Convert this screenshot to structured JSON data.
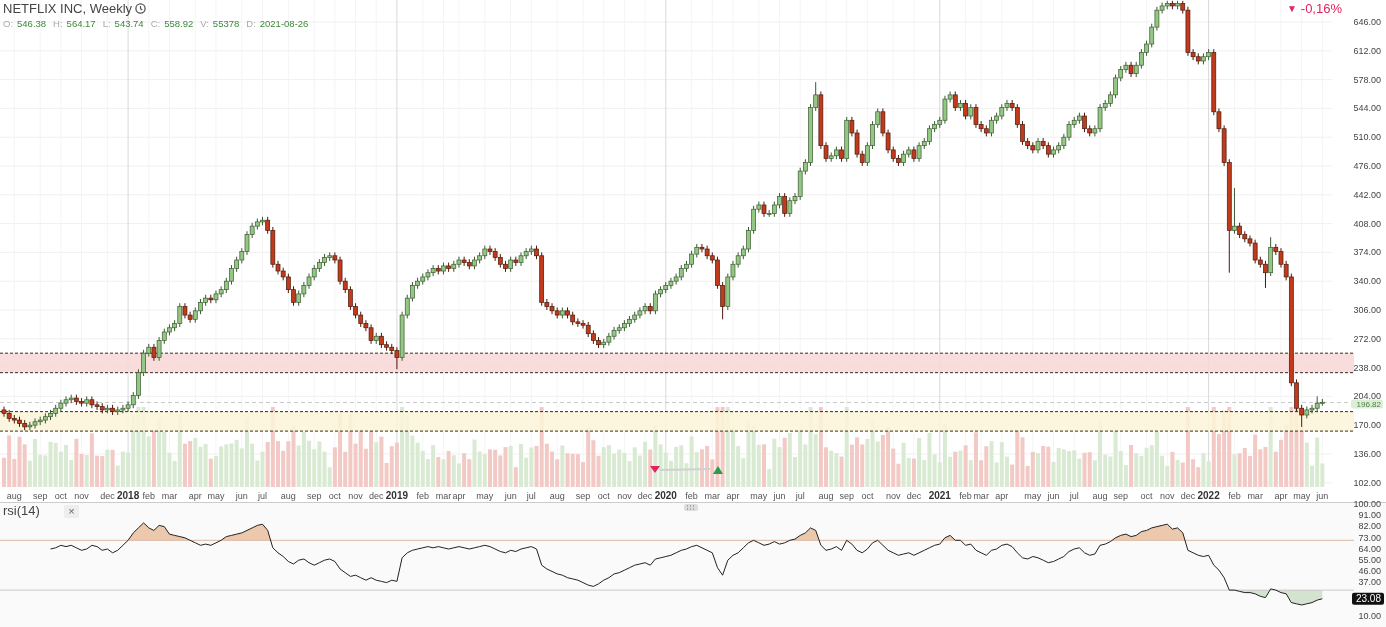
{
  "header": {
    "title": "NETFLIX INC, Weekly",
    "ohlc": [
      {
        "label": "O:",
        "value": "546.38"
      },
      {
        "label": "H:",
        "value": "564.17"
      },
      {
        "label": "L:",
        "value": "543.74"
      },
      {
        "label": "C:",
        "value": "558.92"
      },
      {
        "label": "V:",
        "value": "55378"
      },
      {
        "label": "D:",
        "value": "2021-08-26"
      }
    ]
  },
  "change": {
    "arrow": "▼",
    "text": "-0,16%"
  },
  "price_chart": {
    "chart_data": {
      "type": "candlestick",
      "ylim": [
        97,
        672
      ],
      "grid": true,
      "categories": [
        null,
        null,
        "aug",
        null,
        null,
        null,
        null,
        "sep",
        null,
        null,
        null,
        "oct",
        null,
        null,
        null,
        "nov",
        null,
        null,
        null,
        null,
        "dec",
        null,
        null,
        null,
        "2018",
        null,
        null,
        null,
        "feb",
        null,
        null,
        null,
        "mar",
        null,
        null,
        null,
        null,
        "apr",
        null,
        null,
        null,
        "may",
        null,
        null,
        null,
        null,
        "jun",
        null,
        null,
        null,
        "jul",
        null,
        null,
        null,
        null,
        "aug",
        null,
        null,
        null,
        null,
        "sep",
        null,
        null,
        null,
        "oct",
        null,
        null,
        null,
        "nov",
        null,
        null,
        null,
        "dec",
        null,
        null,
        null,
        "2019",
        null,
        null,
        null,
        null,
        "feb",
        null,
        null,
        null,
        "mar",
        null,
        null,
        "apr",
        null,
        null,
        null,
        null,
        "may",
        null,
        null,
        null,
        null,
        "jun",
        null,
        null,
        null,
        "jul",
        null,
        null,
        null,
        null,
        "aug",
        null,
        null,
        null,
        null,
        "sep",
        null,
        null,
        null,
        "oct",
        null,
        null,
        null,
        "nov",
        null,
        null,
        null,
        "dec",
        null,
        null,
        null,
        "2020",
        null,
        null,
        null,
        null,
        "feb",
        null,
        null,
        null,
        "mar",
        null,
        null,
        null,
        "apr",
        null,
        null,
        null,
        null,
        "may",
        null,
        null,
        null,
        "jun",
        null,
        null,
        null,
        "jul",
        null,
        null,
        null,
        null,
        "aug",
        null,
        null,
        null,
        "sep",
        null,
        null,
        null,
        "oct",
        null,
        null,
        null,
        null,
        "nov",
        null,
        null,
        null,
        "dec",
        null,
        null,
        null,
        null,
        "2021",
        null,
        null,
        null,
        null,
        "feb",
        null,
        null,
        "mar",
        null,
        null,
        null,
        "apr",
        null,
        null,
        null,
        null,
        null,
        "may",
        null,
        null,
        null,
        "jun",
        null,
        null,
        null,
        "jul",
        null,
        null,
        null,
        null,
        "aug",
        null,
        null,
        null,
        "sep",
        null,
        null,
        null,
        null,
        "oct",
        null,
        null,
        null,
        "nov",
        null,
        null,
        null,
        "dec",
        null,
        null,
        null,
        "2022",
        null,
        null,
        null,
        null,
        "feb",
        null,
        null,
        null,
        "mar",
        null,
        null,
        null,
        null,
        "apr",
        null,
        null,
        null,
        "may",
        null,
        null,
        null,
        "jun"
      ],
      "ohlc": [
        [
          188,
          192,
          180,
          184
        ],
        [
          184,
          188,
          174,
          178
        ],
        [
          178,
          182,
          172,
          176
        ],
        [
          176,
          180,
          168,
          172
        ],
        [
          172,
          176,
          164,
          168
        ],
        [
          168,
          174,
          164,
          170
        ],
        [
          170,
          178,
          166,
          174
        ],
        [
          174,
          180,
          170,
          176
        ],
        [
          176,
          184,
          172,
          180
        ],
        [
          180,
          188,
          176,
          184
        ],
        [
          184,
          194,
          180,
          190
        ],
        [
          190,
          200,
          186,
          196
        ],
        [
          196,
          204,
          192,
          200
        ],
        [
          200,
          206,
          196,
          202
        ],
        [
          202,
          206,
          194,
          198
        ],
        [
          198,
          202,
          192,
          196
        ],
        [
          196,
          204,
          192,
          200
        ],
        [
          200,
          204,
          190,
          194
        ],
        [
          194,
          198,
          188,
          192
        ],
        [
          192,
          196,
          184,
          188
        ],
        [
          188,
          194,
          184,
          190
        ],
        [
          190,
          194,
          182,
          186
        ],
        [
          186,
          192,
          182,
          188
        ],
        [
          188,
          194,
          184,
          190
        ],
        [
          190,
          198,
          186,
          194
        ],
        [
          194,
          209,
          190,
          205
        ],
        [
          205,
          236,
          201,
          232
        ],
        [
          232,
          259,
          228,
          255
        ],
        [
          255,
          266,
          251,
          262
        ],
        [
          262,
          266,
          246,
          250
        ],
        [
          250,
          274,
          246,
          270
        ],
        [
          270,
          284,
          266,
          280
        ],
        [
          280,
          289,
          276,
          285
        ],
        [
          285,
          294,
          281,
          290
        ],
        [
          290,
          314,
          286,
          310
        ],
        [
          310,
          314,
          296,
          300
        ],
        [
          300,
          304,
          291,
          295
        ],
        [
          295,
          309,
          291,
          305
        ],
        [
          305,
          319,
          301,
          315
        ],
        [
          315,
          324,
          311,
          320
        ],
        [
          320,
          324,
          314,
          318
        ],
        [
          318,
          329,
          314,
          325
        ],
        [
          325,
          334,
          321,
          330
        ],
        [
          330,
          344,
          326,
          340
        ],
        [
          340,
          359,
          336,
          355
        ],
        [
          355,
          369,
          351,
          365
        ],
        [
          365,
          379,
          361,
          375
        ],
        [
          375,
          399,
          371,
          395
        ],
        [
          395,
          409,
          391,
          405
        ],
        [
          405,
          414,
          401,
          410
        ],
        [
          410,
          416,
          406,
          412
        ],
        [
          412,
          416,
          396,
          400
        ],
        [
          400,
          404,
          356,
          360
        ],
        [
          360,
          364,
          348,
          352
        ],
        [
          352,
          356,
          341,
          345
        ],
        [
          345,
          349,
          326,
          330
        ],
        [
          330,
          334,
          311,
          315
        ],
        [
          315,
          329,
          311,
          325
        ],
        [
          325,
          339,
          321,
          335
        ],
        [
          335,
          349,
          331,
          345
        ],
        [
          345,
          359,
          341,
          355
        ],
        [
          355,
          366,
          351,
          362
        ],
        [
          362,
          372,
          358,
          368
        ],
        [
          368,
          374,
          364,
          370
        ],
        [
          370,
          374,
          361,
          365
        ],
        [
          365,
          369,
          336,
          340
        ],
        [
          340,
          344,
          326,
          330
        ],
        [
          330,
          334,
          306,
          310
        ],
        [
          310,
          314,
          296,
          300
        ],
        [
          300,
          304,
          286,
          290
        ],
        [
          290,
          294,
          281,
          285
        ],
        [
          285,
          289,
          266,
          270
        ],
        [
          270,
          279,
          266,
          275
        ],
        [
          275,
          279,
          261,
          265
        ],
        [
          265,
          269,
          258,
          262
        ],
        [
          262,
          266,
          254,
          258
        ],
        [
          258,
          262,
          236,
          250
        ],
        [
          250,
          304,
          246,
          300
        ],
        [
          300,
          324,
          296,
          320
        ],
        [
          320,
          339,
          316,
          335
        ],
        [
          335,
          344,
          331,
          340
        ],
        [
          340,
          349,
          336,
          345
        ],
        [
          345,
          354,
          341,
          350
        ],
        [
          350,
          359,
          346,
          355
        ],
        [
          355,
          359,
          348,
          352
        ],
        [
          352,
          362,
          348,
          358
        ],
        [
          358,
          362,
          351,
          355
        ],
        [
          355,
          364,
          351,
          360
        ],
        [
          360,
          369,
          356,
          365
        ],
        [
          365,
          369,
          358,
          362
        ],
        [
          362,
          366,
          354,
          358
        ],
        [
          358,
          369,
          354,
          365
        ],
        [
          365,
          374,
          361,
          370
        ],
        [
          370,
          382,
          366,
          378
        ],
        [
          378,
          382,
          371,
          375
        ],
        [
          375,
          379,
          364,
          368
        ],
        [
          368,
          372,
          356,
          360
        ],
        [
          360,
          364,
          351,
          355
        ],
        [
          355,
          369,
          351,
          365
        ],
        [
          365,
          369,
          358,
          362
        ],
        [
          362,
          374,
          358,
          370
        ],
        [
          370,
          379,
          366,
          375
        ],
        [
          375,
          382,
          371,
          378
        ],
        [
          378,
          382,
          366,
          370
        ],
        [
          370,
          374,
          311,
          315
        ],
        [
          315,
          319,
          306,
          310
        ],
        [
          310,
          314,
          301,
          305
        ],
        [
          305,
          309,
          296,
          300
        ],
        [
          300,
          309,
          296,
          305
        ],
        [
          305,
          309,
          296,
          300
        ],
        [
          300,
          304,
          288,
          292
        ],
        [
          292,
          296,
          286,
          290
        ],
        [
          290,
          294,
          284,
          288
        ],
        [
          288,
          292,
          274,
          278
        ],
        [
          278,
          282,
          266,
          270
        ],
        [
          270,
          274,
          261,
          265
        ],
        [
          265,
          272,
          261,
          268
        ],
        [
          268,
          279,
          264,
          275
        ],
        [
          275,
          286,
          271,
          282
        ],
        [
          282,
          289,
          278,
          285
        ],
        [
          285,
          294,
          281,
          290
        ],
        [
          290,
          299,
          286,
          295
        ],
        [
          295,
          304,
          291,
          300
        ],
        [
          300,
          309,
          296,
          305
        ],
        [
          305,
          314,
          301,
          310
        ],
        [
          310,
          314,
          301,
          305
        ],
        [
          305,
          329,
          301,
          325
        ],
        [
          325,
          334,
          321,
          330
        ],
        [
          330,
          339,
          326,
          335
        ],
        [
          335,
          344,
          331,
          340
        ],
        [
          340,
          349,
          336,
          345
        ],
        [
          345,
          359,
          341,
          355
        ],
        [
          355,
          364,
          351,
          360
        ],
        [
          360,
          376,
          356,
          372
        ],
        [
          372,
          384,
          368,
          380
        ],
        [
          380,
          384,
          374,
          378
        ],
        [
          378,
          382,
          366,
          370
        ],
        [
          370,
          374,
          361,
          365
        ],
        [
          365,
          369,
          331,
          335
        ],
        [
          335,
          339,
          295,
          310
        ],
        [
          310,
          349,
          306,
          345
        ],
        [
          345,
          364,
          341,
          360
        ],
        [
          360,
          374,
          356,
          370
        ],
        [
          370,
          382,
          366,
          378
        ],
        [
          378,
          404,
          374,
          400
        ],
        [
          400,
          429,
          396,
          425
        ],
        [
          425,
          434,
          421,
          430
        ],
        [
          430,
          434,
          416,
          420
        ],
        [
          420,
          424,
          416,
          420
        ],
        [
          420,
          434,
          416,
          430
        ],
        [
          430,
          444,
          426,
          440
        ],
        [
          440,
          444,
          416,
          420
        ],
        [
          420,
          439,
          416,
          435
        ],
        [
          435,
          444,
          431,
          440
        ],
        [
          440,
          474,
          436,
          470
        ],
        [
          470,
          484,
          466,
          480
        ],
        [
          480,
          549,
          476,
          545
        ],
        [
          545,
          575,
          541,
          560
        ],
        [
          560,
          564,
          496,
          500
        ],
        [
          500,
          504,
          481,
          485
        ],
        [
          485,
          492,
          481,
          488
        ],
        [
          488,
          499,
          484,
          495
        ],
        [
          495,
          499,
          481,
          485
        ],
        [
          485,
          534,
          481,
          530
        ],
        [
          530,
          534,
          511,
          515
        ],
        [
          515,
          519,
          486,
          490
        ],
        [
          490,
          494,
          476,
          480
        ],
        [
          480,
          504,
          476,
          500
        ],
        [
          500,
          529,
          496,
          525
        ],
        [
          525,
          544,
          521,
          540
        ],
        [
          540,
          544,
          511,
          515
        ],
        [
          515,
          519,
          491,
          495
        ],
        [
          495,
          499,
          481,
          485
        ],
        [
          485,
          489,
          476,
          480
        ],
        [
          480,
          494,
          476,
          490
        ],
        [
          490,
          499,
          486,
          495
        ],
        [
          495,
          499,
          481,
          485
        ],
        [
          485,
          504,
          481,
          500
        ],
        [
          500,
          509,
          496,
          505
        ],
        [
          505,
          524,
          501,
          520
        ],
        [
          520,
          529,
          516,
          525
        ],
        [
          525,
          534,
          521,
          530
        ],
        [
          530,
          559,
          526,
          555
        ],
        [
          555,
          564,
          551,
          560
        ],
        [
          560,
          564,
          541,
          545
        ],
        [
          545,
          554,
          541,
          550
        ],
        [
          550,
          554,
          531,
          535
        ],
        [
          535,
          549,
          531,
          545
        ],
        [
          545,
          549,
          521,
          525
        ],
        [
          525,
          529,
          516,
          520
        ],
        [
          520,
          524,
          511,
          515
        ],
        [
          515,
          534,
          511,
          530
        ],
        [
          530,
          539,
          526,
          535
        ],
        [
          535,
          549,
          531,
          545
        ],
        [
          545,
          554,
          541,
          550
        ],
        [
          550,
          554,
          541,
          545
        ],
        [
          545,
          549,
          521,
          525
        ],
        [
          525,
          529,
          501,
          505
        ],
        [
          505,
          509,
          496,
          500
        ],
        [
          500,
          504,
          491,
          495
        ],
        [
          495,
          509,
          491,
          505
        ],
        [
          505,
          509,
          496,
          500
        ],
        [
          500,
          504,
          486,
          490
        ],
        [
          490,
          499,
          486,
          495
        ],
        [
          495,
          504,
          491,
          500
        ],
        [
          500,
          514,
          496,
          510
        ],
        [
          510,
          529,
          506,
          525
        ],
        [
          525,
          534,
          521,
          530
        ],
        [
          530,
          539,
          526,
          535
        ],
        [
          535,
          539,
          516,
          520
        ],
        [
          520,
          524,
          511,
          515
        ],
        [
          515,
          524,
          511,
          520
        ],
        [
          520,
          549,
          516,
          545
        ],
        [
          545,
          554,
          541,
          550
        ],
        [
          550,
          564,
          546,
          560
        ],
        [
          560,
          584,
          556,
          580
        ],
        [
          580,
          594,
          576,
          590
        ],
        [
          590,
          599,
          586,
          595
        ],
        [
          595,
          599,
          581,
          585
        ],
        [
          585,
          599,
          581,
          595
        ],
        [
          595,
          614,
          591,
          610
        ],
        [
          610,
          624,
          606,
          620
        ],
        [
          620,
          644,
          616,
          640
        ],
        [
          640,
          664,
          636,
          660
        ],
        [
          660,
          669,
          656,
          665
        ],
        [
          665,
          671,
          661,
          668
        ],
        [
          668,
          671,
          661,
          665
        ],
        [
          665,
          671,
          661,
          668
        ],
        [
          668,
          671,
          656,
          660
        ],
        [
          660,
          664,
          606,
          610
        ],
        [
          610,
          614,
          601,
          605
        ],
        [
          605,
          609,
          596,
          600
        ],
        [
          600,
          609,
          596,
          605
        ],
        [
          605,
          614,
          601,
          610
        ],
        [
          610,
          614,
          536,
          540
        ],
        [
          540,
          544,
          516,
          520
        ],
        [
          520,
          524,
          476,
          480
        ],
        [
          480,
          484,
          350,
          400
        ],
        [
          400,
          450,
          396,
          405
        ],
        [
          405,
          409,
          391,
          395
        ],
        [
          395,
          399,
          386,
          390
        ],
        [
          390,
          394,
          381,
          385
        ],
        [
          385,
          389,
          361,
          365
        ],
        [
          365,
          369,
          356,
          360
        ],
        [
          360,
          364,
          332,
          350
        ],
        [
          350,
          392,
          346,
          380
        ],
        [
          380,
          384,
          371,
          375
        ],
        [
          375,
          379,
          356,
          360
        ],
        [
          360,
          364,
          341,
          345
        ],
        [
          345,
          349,
          216,
          220
        ],
        [
          220,
          224,
          186,
          190
        ],
        [
          190,
          194,
          168,
          182
        ],
        [
          182,
          192,
          178,
          188
        ],
        [
          188,
          194,
          184,
          190
        ],
        [
          190,
          204,
          186,
          196
        ],
        [
          196,
          201,
          193,
          197
        ]
      ],
      "yticks": [
        {
          "value": 646,
          "label": "646.00"
        },
        {
          "value": 612,
          "label": "612.00"
        },
        {
          "value": 578,
          "label": "578.00"
        },
        {
          "value": 544,
          "label": "544.00"
        },
        {
          "value": 510,
          "label": "510.00"
        },
        {
          "value": 476,
          "label": "476.00"
        },
        {
          "value": 442,
          "label": "442.00"
        },
        {
          "value": 408,
          "label": "408.00"
        },
        {
          "value": 374,
          "label": "374.00"
        },
        {
          "value": 340,
          "label": "340.00"
        },
        {
          "value": 306,
          "label": "306.00"
        },
        {
          "value": 272,
          "label": "272.00"
        },
        {
          "value": 238,
          "label": "238.00"
        },
        {
          "value": 204,
          "label": "204.00"
        },
        {
          "value": 170,
          "label": "170.00"
        },
        {
          "value": 136,
          "label": "136.00"
        },
        {
          "value": 102,
          "label": "102.00"
        }
      ],
      "bands": [
        {
          "axis": "y",
          "from": 232,
          "to": 255,
          "color": "#f8d6d6"
        },
        {
          "axis": "y",
          "from": 163,
          "to": 186,
          "color": "#fcf5d8"
        }
      ],
      "ref_lines": [
        {
          "axis": "y",
          "value": 196.82,
          "label": "196.82"
        }
      ]
    }
  },
  "rsi": {
    "title": "rsi(14)",
    "close_label": "×",
    "reading": "23.08",
    "chart_data": {
      "type": "line",
      "ylim": [
        10,
        100
      ],
      "series": [
        {
          "values": [
            null,
            null,
            null,
            null,
            null,
            null,
            null,
            null,
            null,
            63,
            64,
            66,
            65,
            66,
            64,
            62,
            63,
            66,
            65,
            62,
            63,
            60,
            62,
            66,
            70,
            76,
            80,
            84,
            80,
            78,
            82,
            81,
            75,
            74,
            73,
            72,
            70,
            68,
            66,
            67,
            66,
            68,
            70,
            73,
            74,
            75,
            76,
            78,
            80,
            82,
            83,
            78,
            64,
            60,
            57,
            53,
            51,
            54,
            55,
            52,
            50,
            52,
            54,
            55,
            53,
            47,
            44,
            41,
            42,
            40,
            38,
            40,
            38,
            37,
            36,
            38,
            37,
            56,
            60,
            62,
            63,
            64,
            65,
            64,
            65,
            64,
            63,
            64,
            65,
            64,
            63,
            64,
            65,
            66,
            65,
            63,
            61,
            60,
            62,
            61,
            63,
            64,
            65,
            63,
            50,
            47,
            45,
            43,
            42,
            40,
            39,
            38,
            36,
            34,
            33,
            35,
            38,
            40,
            43,
            44,
            46,
            48,
            50,
            51,
            52,
            50,
            55,
            56,
            57,
            58,
            60,
            62,
            63,
            65,
            66,
            64,
            62,
            60,
            48,
            42,
            54,
            58,
            60,
            64,
            68,
            70,
            68,
            66,
            67,
            69,
            67,
            68,
            70,
            71,
            74,
            76,
            80,
            78,
            66,
            62,
            63,
            65,
            62,
            70,
            67,
            62,
            60,
            63,
            68,
            70,
            66,
            62,
            60,
            58,
            59,
            60,
            58,
            60,
            62,
            64,
            66,
            67,
            72,
            74,
            70,
            70,
            66,
            67,
            62,
            60,
            58,
            62,
            63,
            66,
            67,
            65,
            60,
            56,
            55,
            57,
            56,
            54,
            52,
            53,
            55,
            57,
            61,
            63,
            64,
            60,
            58,
            59,
            66,
            67,
            69,
            72,
            74,
            75,
            73,
            74,
            77,
            78,
            80,
            81,
            82,
            83,
            79,
            80,
            76,
            62,
            60,
            58,
            57,
            58,
            50,
            46,
            40,
            30,
            30,
            29,
            28,
            28,
            27,
            25,
            24,
            31,
            30,
            28,
            27,
            20,
            19,
            18,
            19,
            20,
            22,
            23
          ]
        }
      ],
      "yticks": [
        {
          "value": 100,
          "label": "100.00"
        },
        {
          "value": 91,
          "label": "91.00"
        },
        {
          "value": 82,
          "label": "82.00"
        },
        {
          "value": 73,
          "label": "73.00"
        },
        {
          "value": 64,
          "label": "64.00"
        },
        {
          "value": 55,
          "label": "55.00"
        },
        {
          "value": 46,
          "label": "46.00"
        },
        {
          "value": 37,
          "label": "37.00"
        },
        {
          "value": 10,
          "label": "10.00"
        }
      ],
      "ref_lines": [
        {
          "axis": "y",
          "value": 70,
          "color": "#dcb9a4"
        },
        {
          "axis": "y",
          "value": 30,
          "color": "#c9c9c9"
        }
      ]
    }
  }
}
